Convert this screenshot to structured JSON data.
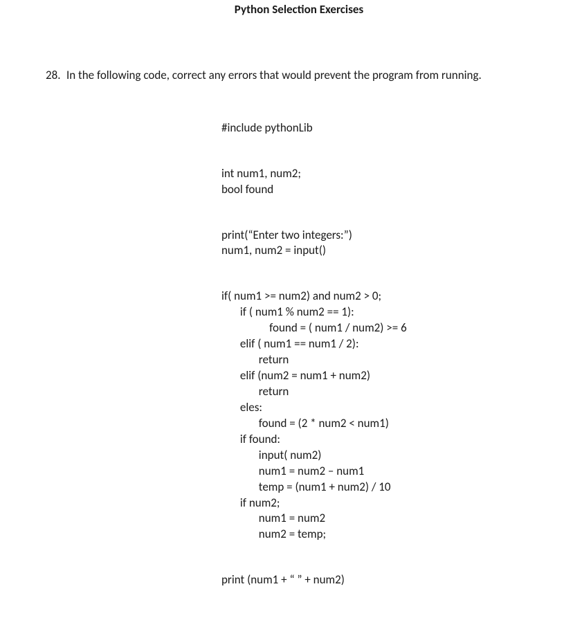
{
  "title": "Python Selection Exercises",
  "question": {
    "number": "28.",
    "text": "In the following code, correct any errors that would prevent the program from running."
  },
  "code": {
    "line1": "#include pythonLib",
    "line2": "int num1, num2;",
    "line3": "bool found",
    "line4": "print(“Enter two integers:”)",
    "line5": "num1, num2 = input()",
    "line6": "if( num1 >= num2) and num2 > 0;",
    "line7": "       if ( num1 % num2 == 1):",
    "line8": "                  found = ( num1 / num2) >= 6",
    "line9": "       elif ( num1 == num1 / 2):",
    "line10": "              return",
    "line11": "       elif (num2 = num1 + num2)",
    "line12": "              return",
    "line13": "       eles:",
    "line14": "              found = (2 * num2 < num1)",
    "line15": "       if found:",
    "line16": "              input( num2)",
    "line17": "              num1 = num2 – num1",
    "line18": "              temp = (num1 + num2) / 10",
    "line19": "       if num2;",
    "line20": "              num1 = num2",
    "line21": "              num2 = temp;",
    "line22": "print (num1 + “ ” + num2)"
  }
}
